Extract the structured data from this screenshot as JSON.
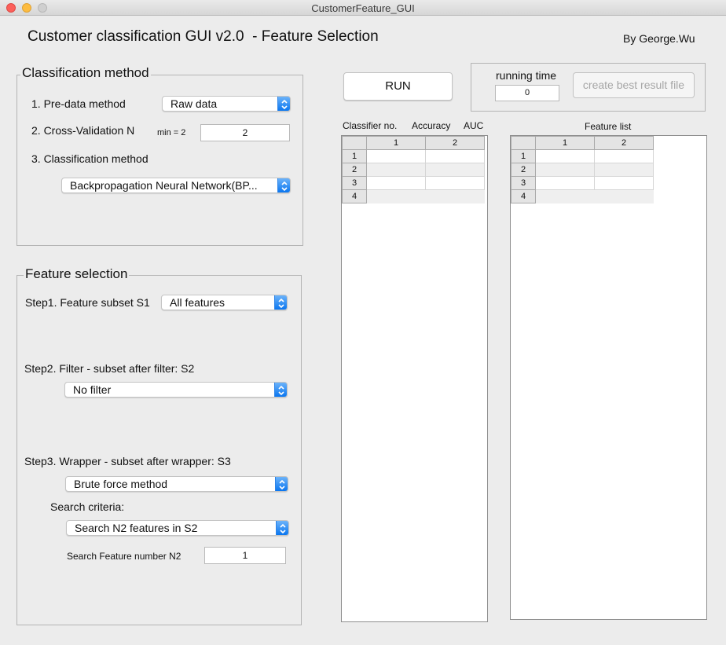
{
  "window": {
    "title": "CustomerFeature_GUI"
  },
  "header": {
    "title": "Customer classification GUI v2.0  - Feature Selection",
    "author": "By George.Wu"
  },
  "classification_panel": {
    "title": "Classification method",
    "pre_data_label": "1. Pre-data method",
    "pre_data_value": "Raw data",
    "cv_label": "2. Cross-Validation N",
    "cv_hint": "min = 2",
    "cv_value": "2",
    "method_label": "3. Classification method",
    "method_value": "Backpropagation Neural Network(BP..."
  },
  "feature_panel": {
    "title": "Feature selection",
    "step1_label": "Step1. Feature subset S1",
    "step1_value": "All features",
    "step2_label": "Step2. Filter - subset after filter: S2",
    "step2_value": "No filter",
    "step3_label": "Step3. Wrapper - subset after wrapper: S3",
    "step3_value": "Brute force method",
    "search_criteria_label": "Search criteria:",
    "search_criteria_value": "Search N2 features in S2",
    "n2_label": "Search Feature number N2",
    "n2_value": "1"
  },
  "run": {
    "button_label": "RUN",
    "running_time_label": "running time",
    "running_time_value": "0",
    "create_file_label": "create best result file"
  },
  "results": {
    "headers": [
      "Classifier no.",
      "Accuracy",
      "AUC"
    ],
    "columns": [
      "1",
      "2"
    ],
    "rows": [
      "1",
      "2",
      "3",
      "4"
    ]
  },
  "features": {
    "header": "Feature list",
    "columns": [
      "1",
      "2"
    ],
    "rows": [
      "1",
      "2",
      "3",
      "4"
    ]
  },
  "colors": {
    "accent": "#0a76f0",
    "close": "#fc605b",
    "minimize": "#fdbc40"
  }
}
